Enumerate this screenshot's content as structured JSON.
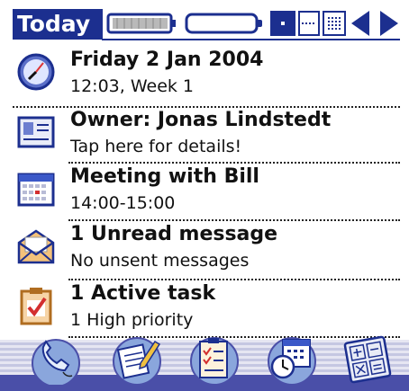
{
  "header": {
    "title": "Today",
    "accent": "#1c2f8f"
  },
  "items": [
    {
      "line1": "Friday 2 Jan 2004",
      "line2": "12:03, Week 1",
      "icon": "clock-icon"
    },
    {
      "line1": "Owner: Jonas Lindstedt",
      "line2": "Tap here for details!",
      "icon": "contact-card-icon"
    },
    {
      "line1": "Meeting with Bill",
      "line2": "14:00-15:00",
      "icon": "calendar-icon"
    },
    {
      "line1": "1 Unread message",
      "line2": "No unsent messages",
      "icon": "envelope-icon"
    },
    {
      "line1": "1 Active task",
      "line2": "1 High priority",
      "icon": "clipboard-task-icon"
    }
  ],
  "launcher": [
    "phone-icon",
    "notes-icon",
    "tasks-icon",
    "calendar-clock-icon",
    "calculator-icon"
  ]
}
